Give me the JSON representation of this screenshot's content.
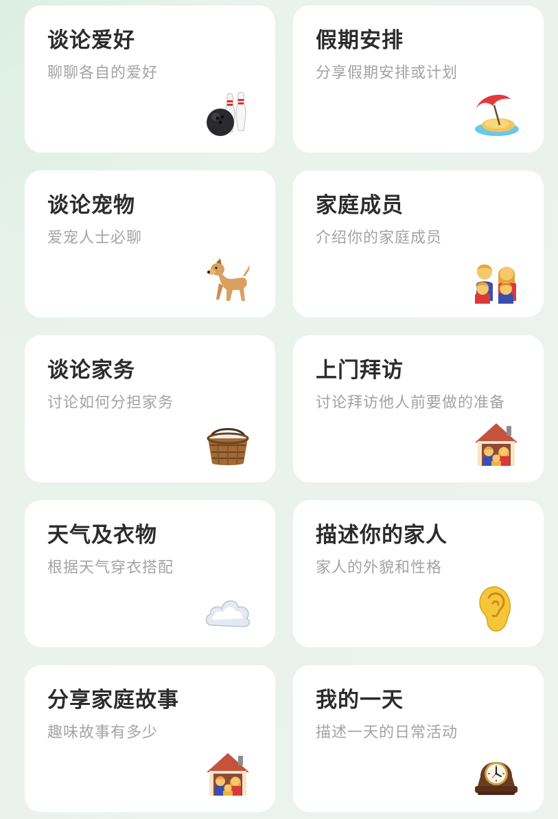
{
  "topics": [
    {
      "title": "谈论爱好",
      "subtitle": "聊聊各自的爱好",
      "icon": "bowling-icon"
    },
    {
      "title": "假期安排",
      "subtitle": "分享假期安排或计划",
      "icon": "beach-umbrella-icon"
    },
    {
      "title": "谈论宠物",
      "subtitle": "爱宠人士必聊",
      "icon": "dog-icon"
    },
    {
      "title": "家庭成员",
      "subtitle": "介绍你的家庭成员",
      "icon": "family-icon"
    },
    {
      "title": "谈论家务",
      "subtitle": "讨论如何分担家务",
      "icon": "laundry-basket-icon"
    },
    {
      "title": "上门拜访",
      "subtitle": "讨论拜访他人前要做的准备",
      "icon": "house-family-icon"
    },
    {
      "title": "天气及衣物",
      "subtitle": "根据天气穿衣搭配",
      "icon": "cloud-icon"
    },
    {
      "title": "描述你的家人",
      "subtitle": "家人的外貌和性格",
      "icon": "ear-icon"
    },
    {
      "title": "分享家庭故事",
      "subtitle": "趣味故事有多少",
      "icon": "house-family-icon"
    },
    {
      "title": "我的一天",
      "subtitle": "描述一天的日常活动",
      "icon": "mantel-clock-icon"
    }
  ]
}
